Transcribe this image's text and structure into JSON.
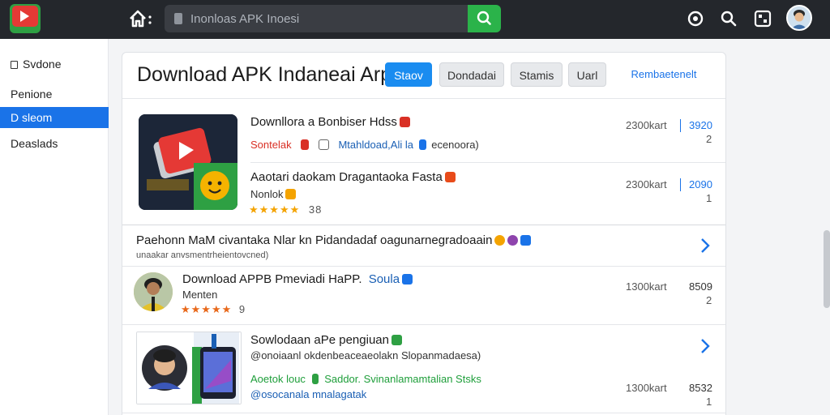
{
  "topbar": {
    "search_placeholder": "Inonloas APK Inoesi"
  },
  "sidebar": {
    "items": [
      {
        "label": "Svdone"
      },
      {
        "label": "Penione"
      },
      {
        "label": "D sleom"
      },
      {
        "label": "Deaslads"
      }
    ]
  },
  "main": {
    "title": "Download APK Indaneai Arp",
    "tabs": [
      {
        "label": "Staov"
      },
      {
        "label": "Dondadai"
      },
      {
        "label": "Stamis"
      },
      {
        "label": "Uarl"
      },
      {
        "label": "Rembaetenelt"
      }
    ],
    "featured": {
      "row1": {
        "title": "Downllora a Bonbiser Hdss",
        "sub_red": "Sontelak",
        "sub_blue": "Mtahldoad,Ali la",
        "sub_gray": "ecenoora)",
        "downloads": "2300kart",
        "count": "3920",
        "count2": "2"
      },
      "row2": {
        "title": "Aaotari daokam Dragantaoka Fasta",
        "sub": "Nonlok",
        "stars": "★★★★★",
        "rating": "38",
        "downloads": "2300kart",
        "count": "2090",
        "count2": "1"
      }
    },
    "banner": {
      "title": "Paehonn MaM civantaka Nlar kn Pidandadaf oagunarnegradoaain",
      "sub": "unaakar anvsmentrheientovcned)"
    },
    "list": [
      {
        "title": "Download APPB Pmeviadi HaPP.",
        "tag": "Soula",
        "sub": "Menten",
        "stars": "★★★★★",
        "rating": "9",
        "downloads": "1300kart",
        "count": "8509",
        "count2": "2"
      },
      {
        "title": "Sowlodaan aPe pengiuan",
        "sub": "@onoiaanl okdenbeaceaeolakn Slopanmadaesa)",
        "green": "Aoetok louc",
        "green2": "Saddor. Svinanlamamtalian Stsks",
        "blue": "@osocanala mnalagatak",
        "downloads": "1300kart",
        "count": "8532",
        "count2": "1"
      }
    ]
  }
}
